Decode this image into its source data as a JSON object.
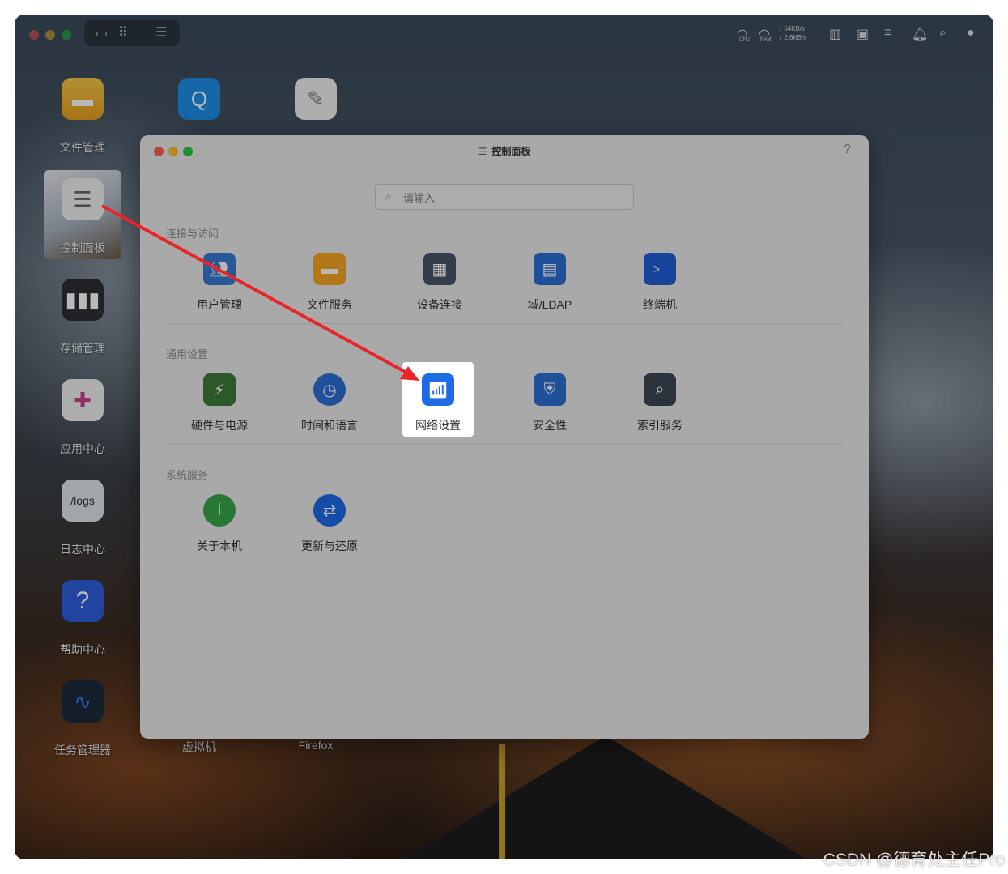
{
  "desktop": {
    "icons": [
      {
        "label": "文件管理",
        "icon": "folder-icon"
      },
      {
        "label": "控制面板",
        "icon": "sliders-icon"
      },
      {
        "label": "存储管理",
        "icon": "storage-icon"
      },
      {
        "label": "应用中心",
        "icon": "apps-icon"
      },
      {
        "label": "日志中心",
        "icon": "logs-icon",
        "text": "/logs"
      },
      {
        "label": "帮助中心",
        "icon": "help-icon",
        "text": "?"
      },
      {
        "label": "任务管理器",
        "icon": "activity-icon"
      },
      {
        "label": "虚拟机",
        "icon": "search-app-icon"
      },
      {
        "label": "Firefox",
        "icon": "notes-icon"
      }
    ]
  },
  "topbar": {
    "cpu_label": "CPU",
    "ram_label": "RAM",
    "up_speed": "↑ 64KB/s",
    "down_speed": "↓ 2.6KB/s"
  },
  "window": {
    "title": "控制面板",
    "help": "?",
    "search_placeholder": "请输入",
    "sections": [
      {
        "title": "连接与访问",
        "items": [
          {
            "label": "用户管理",
            "icon": "users-icon",
            "color": "#3a7bd5"
          },
          {
            "label": "文件服务",
            "icon": "folder-icon",
            "color": "#f5a623"
          },
          {
            "label": "设备连接",
            "icon": "device-icon",
            "color": "#4a5568"
          },
          {
            "label": "域/LDAP",
            "icon": "id-card-icon",
            "color": "#2f6fd6"
          },
          {
            "label": "终端机",
            "icon": "terminal-icon",
            "color": "#1e5fd6"
          }
        ]
      },
      {
        "title": "通用设置",
        "items": [
          {
            "label": "硬件与电源",
            "icon": "battery-icon",
            "color": "#3f7b3a"
          },
          {
            "label": "时间和语言",
            "icon": "globe-clock-icon",
            "color": "#2f6fd6"
          },
          {
            "label": "网络设置",
            "icon": "router-icon",
            "color": "#1e6be6"
          },
          {
            "label": "安全性",
            "icon": "shield-icon",
            "color": "#2f6fd6"
          },
          {
            "label": "索引服务",
            "icon": "index-search-icon",
            "color": "#3c4650"
          }
        ]
      },
      {
        "title": "系统服务",
        "items": [
          {
            "label": "关于本机",
            "icon": "info-icon",
            "color": "#3aa64a"
          },
          {
            "label": "更新与还原",
            "icon": "refresh-icon",
            "color": "#1e6be6"
          }
        ]
      }
    ]
  },
  "watermark": "CSDN @德育处主任Pro"
}
